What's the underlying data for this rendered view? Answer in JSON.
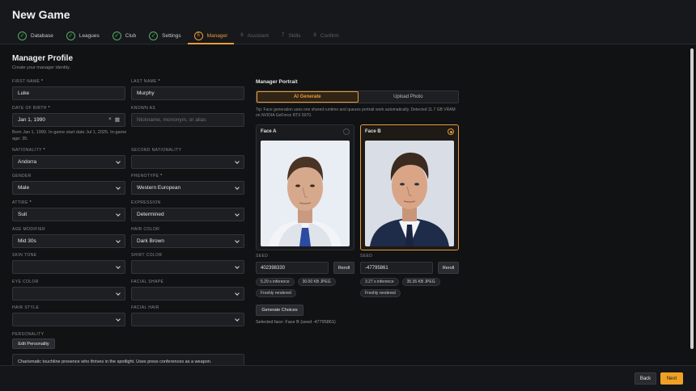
{
  "app": {
    "title": "New Game"
  },
  "steps": [
    {
      "label": "Database",
      "state": "done",
      "mark": "✓"
    },
    {
      "label": "Leagues",
      "state": "done",
      "mark": "✓"
    },
    {
      "label": "Club",
      "state": "done",
      "mark": "✓"
    },
    {
      "label": "Settings",
      "state": "done",
      "mark": "✓"
    },
    {
      "label": "Manager",
      "state": "active",
      "mark": "5"
    },
    {
      "label": "Assistant",
      "state": "disabled",
      "mark": "6"
    },
    {
      "label": "Skills",
      "state": "disabled",
      "mark": "7"
    },
    {
      "label": "Confirm",
      "state": "disabled",
      "mark": "8"
    }
  ],
  "profile": {
    "title": "Manager Profile",
    "subtitle": "Create your manager identity.",
    "first_name": {
      "label": "FIRST NAME",
      "value": "Luke"
    },
    "last_name": {
      "label": "LAST NAME",
      "value": "Murphy"
    },
    "dob": {
      "label": "DATE OF BIRTH",
      "value": "Jan 1, 1990",
      "clear_icon": "×",
      "calendar_icon": "▦"
    },
    "known_as": {
      "label": "KNOWN AS",
      "placeholder": "Nickname, mononym, or alias"
    },
    "dob_hint": "Born Jan 1, 1990. In-game start date Jul 1, 2025. In-game age: 35.",
    "nationality": {
      "label": "NATIONALITY",
      "value": "Andorra"
    },
    "second_nationality": {
      "label": "SECOND NATIONALITY",
      "value": ""
    },
    "gender": {
      "label": "GENDER",
      "value": "Male"
    },
    "phenotype": {
      "label": "PHENOTYPE",
      "value": "Western European"
    },
    "attire": {
      "label": "ATTIRE",
      "value": "Suit"
    },
    "expression": {
      "label": "EXPRESSION",
      "value": "Determined"
    },
    "age_modifier": {
      "label": "AGE MODIFIER",
      "value": "Mid 30s"
    },
    "hair_color": {
      "label": "HAIR COLOR",
      "value": "Dark Brown"
    },
    "skin_tone": {
      "label": "SKIN TONE",
      "value": ""
    },
    "shirt_color": {
      "label": "SHIRT COLOR",
      "value": ""
    },
    "eye_color": {
      "label": "EYE COLOR",
      "value": ""
    },
    "facial_shape": {
      "label": "FACIAL SHAPE",
      "value": ""
    },
    "hair_style": {
      "label": "HAIR STYLE",
      "value": ""
    },
    "facial_hair": {
      "label": "FACIAL HAIR",
      "value": ""
    },
    "personality": {
      "label": "PERSONALITY",
      "edit_button": "Edit Personality",
      "text": "Charismatic touchline presence who thrives in the spotlight. Uses press conferences as a weapon."
    },
    "required_mark": "*"
  },
  "portrait": {
    "title": "Manager Portrait",
    "tabs": [
      "AI Generate",
      "Upload Photo"
    ],
    "tip": "Tip: Face generation uses one shared runtime and queues portrait work automatically. Detected 11.7 GB VRAM on NVIDIA GeForce RTX 5070.",
    "faces": [
      {
        "title": "Face A",
        "selected": false,
        "seed_label": "SEED",
        "seed": "402398330",
        "reroll": "Reroll",
        "pills": [
          "5.29 s inference",
          "30.00 KB JPEG",
          "Freshly rendered"
        ]
      },
      {
        "title": "Face B",
        "selected": true,
        "seed_label": "SEED",
        "seed": "-47795861",
        "reroll": "Reroll",
        "pills": [
          "3.27 s inference",
          "35.36 KB JPEG",
          "Freshly rendered"
        ]
      }
    ],
    "generate_button": "Generate Choices",
    "selected_text": "Selected face: Face B (seed -47795861)"
  },
  "footer": {
    "back": "Back",
    "next": "Next"
  },
  "colors": {
    "accent": "#e89b3b",
    "next": "#f0a125",
    "done": "#4fae63",
    "bg": "#111214"
  }
}
